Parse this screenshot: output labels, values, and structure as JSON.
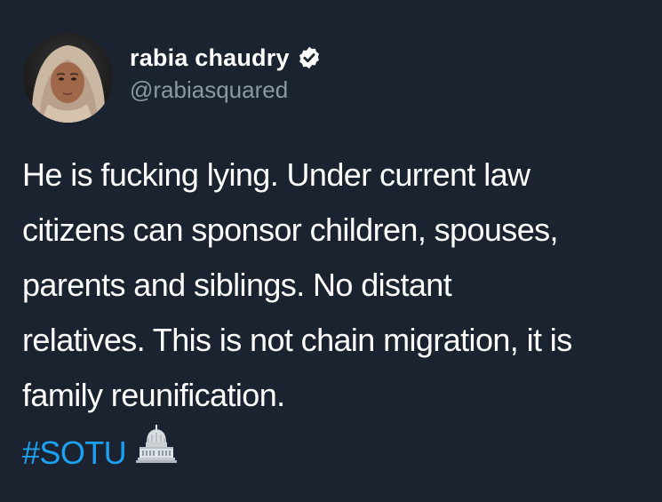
{
  "author": {
    "display_name": "rabia chaudry",
    "handle": "@rabiasquared",
    "verified": true,
    "avatar_icon": "profile-photo-woman-headscarf"
  },
  "tweet": {
    "lines": [
      "He is fucking lying.  Under current law",
      "citizens can sponsor children, spouses,",
      "parents and siblings. No distant",
      "relatives. This is not chain migration, it is",
      "family reunification."
    ],
    "hashtag": "#SOTU",
    "emoji_icon": "capitol-building-icon"
  },
  "colors": {
    "background": "#1b2330",
    "text": "#ffffff",
    "handle": "#8b98a5",
    "hashtag": "#1da1f2"
  }
}
